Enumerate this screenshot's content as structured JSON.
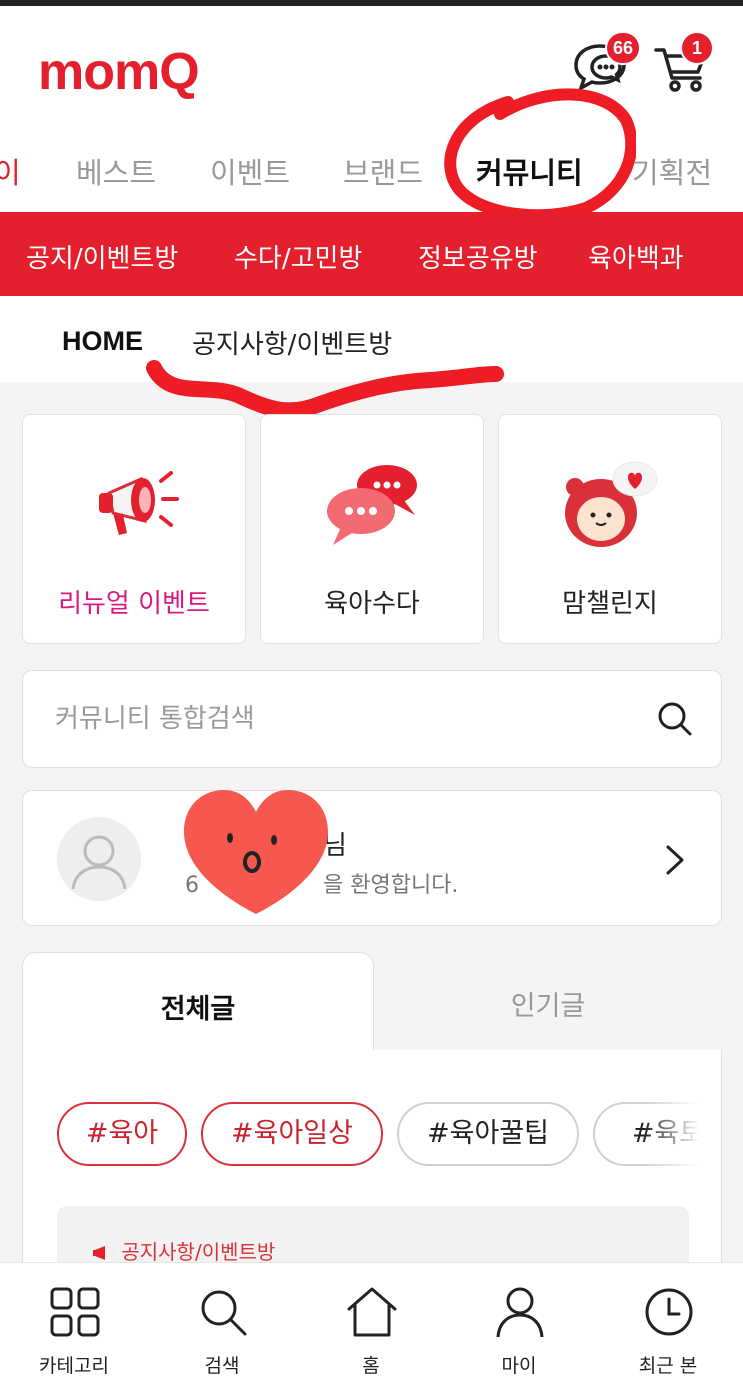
{
  "header": {
    "logo": "momQ",
    "chat_badge": "66",
    "cart_badge": "1"
  },
  "main_nav": [
    {
      "label": "이"
    },
    {
      "label": "베스트"
    },
    {
      "label": "이벤트"
    },
    {
      "label": "브랜드"
    },
    {
      "label": "커뮤니티"
    },
    {
      "label": "기획전"
    }
  ],
  "sub_nav": [
    {
      "label": "공지/이벤트방"
    },
    {
      "label": "수다/고민방"
    },
    {
      "label": "정보공유방"
    },
    {
      "label": "육아백과"
    }
  ],
  "breadcrumb": {
    "home": "HOME",
    "current": "공지사항/이벤트방"
  },
  "tiles": [
    {
      "label": "리뉴얼 이벤트",
      "icon": "megaphone-icon"
    },
    {
      "label": "육아수다",
      "icon": "speech-bubbles-icon"
    },
    {
      "label": "맘챌린지",
      "icon": "character-heart-icon"
    }
  ],
  "search": {
    "placeholder": "커뮤니티 통합검색"
  },
  "profile": {
    "name_suffix": "님",
    "welcome_prefix": "6",
    "welcome_suffix": "을 환영합니다."
  },
  "tabs": [
    {
      "label": "전체글"
    },
    {
      "label": "인기글"
    }
  ],
  "tags": [
    {
      "label": "#육아",
      "style": "red"
    },
    {
      "label": "#육아일상",
      "style": "red"
    },
    {
      "label": "#육아꿀팁",
      "style": "gray"
    },
    {
      "label": "#육토",
      "style": "gray"
    }
  ],
  "notice": {
    "label": "공지사항/이벤트방"
  },
  "bottom_nav": [
    {
      "label": "카테고리",
      "icon": "grid-icon"
    },
    {
      "label": "검색",
      "icon": "search-icon"
    },
    {
      "label": "홈",
      "icon": "home-icon"
    },
    {
      "label": "마이",
      "icon": "person-icon"
    },
    {
      "label": "최근 본",
      "icon": "clock-icon"
    }
  ],
  "colors": {
    "brand_red": "#e5202e",
    "tag_red": "#d9303a",
    "event_pink": "#d81b7d"
  }
}
